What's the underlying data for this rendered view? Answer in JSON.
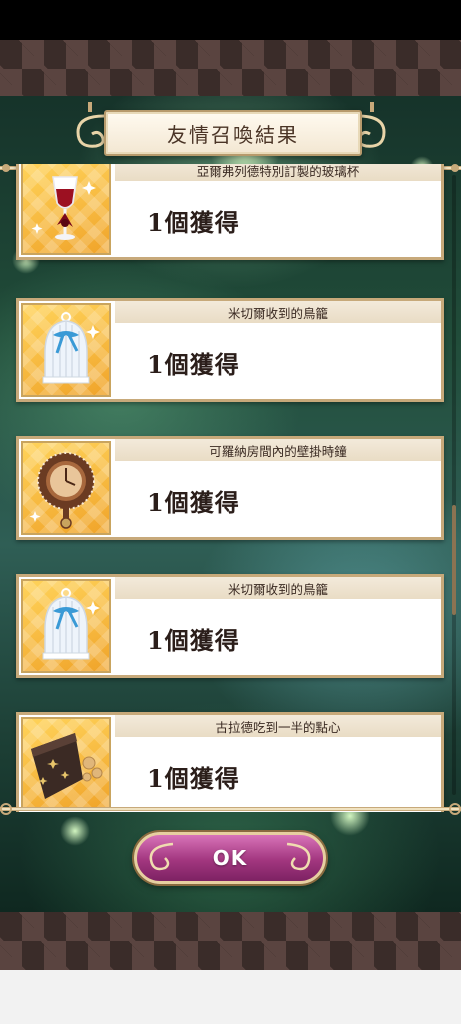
{
  "title": "友情召喚結果",
  "items": [
    {
      "name": "亞爾弗列德特別訂製的玻璃杯",
      "count_text": "1個獲得",
      "icon": "wine-glass-icon"
    },
    {
      "name": "米切爾收到的鳥籠",
      "count_text": "1個獲得",
      "icon": "birdcage-icon"
    },
    {
      "name": "可羅納房間內的壁掛時鐘",
      "count_text": "1個獲得",
      "icon": "wall-clock-icon"
    },
    {
      "name": "米切爾收到的鳥籠",
      "count_text": "1個獲得",
      "icon": "birdcage-icon"
    },
    {
      "name": "古拉德吃到一半的點心",
      "count_text": "1個獲得",
      "icon": "snack-bag-icon"
    }
  ],
  "ok_label": "OK",
  "colors": {
    "frame_gold": "#c7a97a",
    "button_magenta": "#a2367f",
    "band_brown": "#3a2c29",
    "icon_yellow": "#f0a42a"
  }
}
